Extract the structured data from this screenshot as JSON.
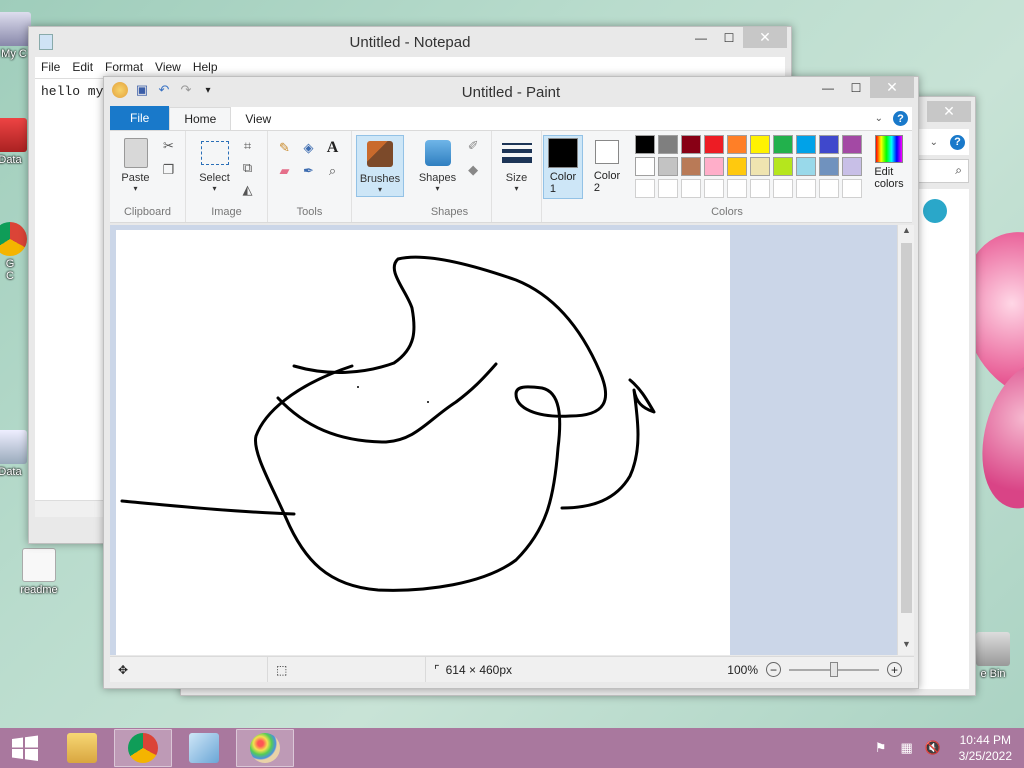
{
  "desktop": {
    "icons": [
      {
        "label": "My C"
      },
      {
        "label": "Data"
      },
      {
        "label": "G\nC"
      },
      {
        "label": "Data"
      },
      {
        "label": "readme"
      },
      {
        "label": "e Bin"
      }
    ]
  },
  "notepad": {
    "title": "Untitled - Notepad",
    "menu": [
      "File",
      "Edit",
      "Format",
      "View",
      "Help"
    ],
    "text": "hello my"
  },
  "paint": {
    "title": "Untitled - Paint",
    "tabs": [
      "File",
      "Home",
      "View"
    ],
    "groups": {
      "clipboard": {
        "label": "Clipboard",
        "paste": "Paste"
      },
      "image": {
        "label": "Image",
        "select": "Select"
      },
      "tools": {
        "label": "Tools"
      },
      "brushes": {
        "label": "Brushes"
      },
      "shapes": {
        "label": "Shapes",
        "button": "Shapes"
      },
      "size": {
        "label": "Size"
      },
      "colors": {
        "label": "Colors",
        "color1": "Color\n1",
        "color2": "Color\n2",
        "edit": "Edit\ncolors",
        "color1_value": "#000000",
        "color2_value": "#ffffff",
        "palette": [
          "#000000",
          "#7f7f7f",
          "#880015",
          "#ed1c24",
          "#ff7f27",
          "#fff200",
          "#22b14c",
          "#00a2e8",
          "#3f48cc",
          "#a349a4",
          "#ffffff",
          "#c3c3c3",
          "#b97a57",
          "#ffaec9",
          "#ffc90e",
          "#efe4b0",
          "#b5e61d",
          "#99d9ea",
          "#7092be",
          "#c8bfe7",
          "#ffffff",
          "#ffffff",
          "#ffffff",
          "#ffffff",
          "#ffffff",
          "#ffffff",
          "#ffffff",
          "#ffffff",
          "#ffffff",
          "#ffffff"
        ]
      }
    },
    "status": {
      "canvas_size": "614 × 460px",
      "zoom": "100%"
    }
  },
  "taskbar": {
    "time": "10:44 PM",
    "date": "3/25/2022"
  }
}
